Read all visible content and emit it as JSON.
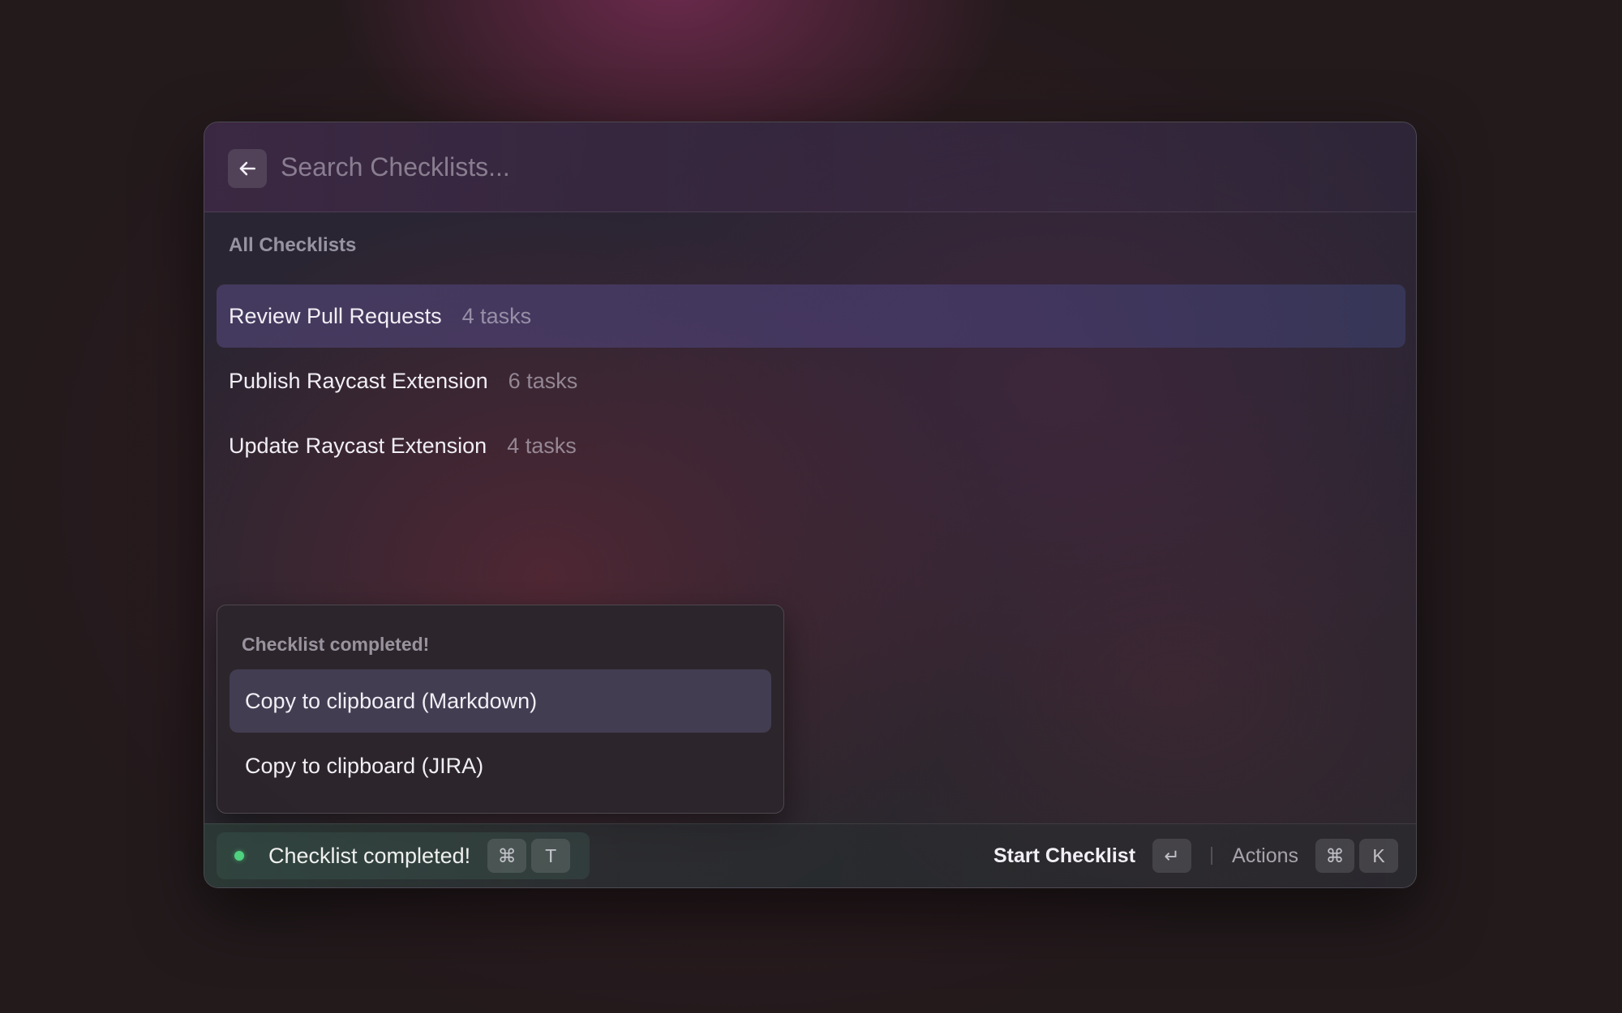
{
  "search": {
    "placeholder": "Search Checklists...",
    "value": ""
  },
  "back_icon": "arrow-left-icon",
  "list": {
    "section_title": "All Checklists",
    "items": [
      {
        "title": "Review Pull Requests",
        "subtitle": "4 tasks",
        "selected": true
      },
      {
        "title": "Publish Raycast Extension",
        "subtitle": "6 tasks",
        "selected": false
      },
      {
        "title": "Update Raycast Extension",
        "subtitle": "4 tasks",
        "selected": false
      }
    ]
  },
  "popover": {
    "title": "Checklist completed!",
    "items": [
      {
        "label": "Copy to clipboard (Markdown)",
        "selected": true
      },
      {
        "label": "Copy to clipboard (JIRA)",
        "selected": false
      }
    ]
  },
  "footer": {
    "toast": {
      "text": "Checklist completed!",
      "status_color": "#4fd17f",
      "shortcut": [
        "⌘",
        "T"
      ]
    },
    "primary_action": {
      "label": "Start Checklist",
      "shortcut": "↵"
    },
    "secondary_action": {
      "label": "Actions",
      "shortcut": [
        "⌘",
        "K"
      ]
    }
  }
}
